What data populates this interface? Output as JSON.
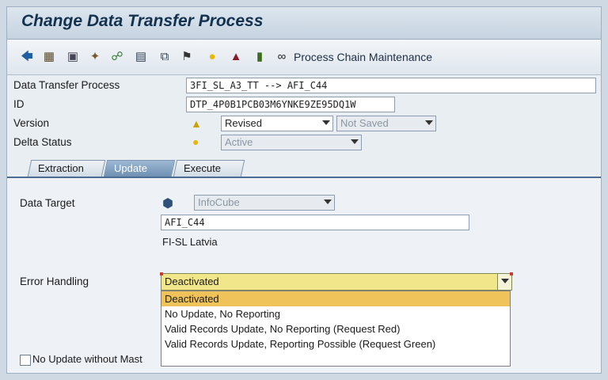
{
  "window": {
    "title": "Change Data Transfer Process"
  },
  "toolbar": {
    "icons": [
      "back-arrow-icon",
      "hierarchy-icon",
      "display-icon",
      "wand-icon",
      "connect-icon",
      "screen-icon",
      "copy-icon",
      "lock-icon",
      "info-icon",
      "hat-icon",
      "battery-icon",
      "glasses-icon"
    ],
    "process_chain_label": "Process Chain Maintenance"
  },
  "header": {
    "dtp": {
      "label": "Data Transfer Process",
      "value": "3FI_SL_A3_TT --> AFI_C44"
    },
    "id": {
      "label": "ID",
      "value": "DTP_4P0B1PCB03M6YNKE9ZE95DQ1W"
    },
    "version": {
      "label": "Version",
      "value": "Revised",
      "save_state": "Not Saved"
    },
    "delta": {
      "label": "Delta Status",
      "value": "Active"
    }
  },
  "tabs": [
    {
      "label": "Extraction",
      "active": false
    },
    {
      "label": "Update",
      "active": true
    },
    {
      "label": "Execute",
      "active": false
    }
  ],
  "update_tab": {
    "data_target": {
      "label": "Data Target",
      "type": "InfoCube",
      "name": "AFI_C44",
      "description": "FI-SL Latvia"
    },
    "error_handling": {
      "label": "Error Handling",
      "selected": "Deactivated",
      "options": [
        "Deactivated",
        "No Update, No Reporting",
        "Valid Records Update, No Reporting (Request Red)",
        "Valid Records Update, Reporting Possible (Request Green)"
      ]
    },
    "no_update_checkbox_label": "No Update without Mast"
  },
  "colors": {
    "accent": "#4d6d90",
    "dropdown_field": "#f1e68a",
    "dropdown_selected": "#f0c35a",
    "warning": "#e6b800"
  }
}
